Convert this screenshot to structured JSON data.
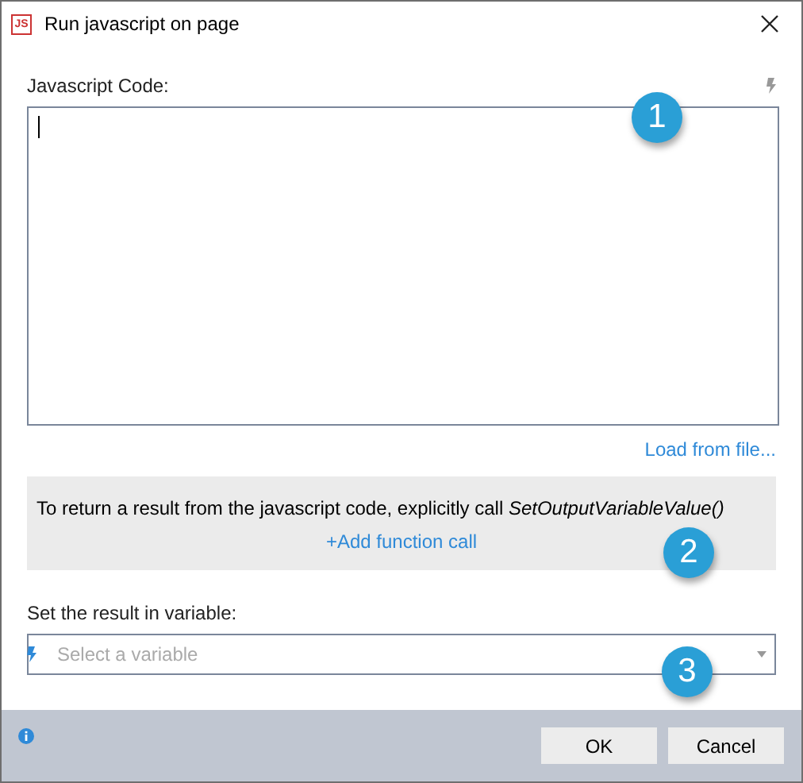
{
  "window": {
    "title": "Run javascript on page",
    "app_icon": "JS"
  },
  "code": {
    "label": "Javascript Code:",
    "focused": true,
    "callout": "1"
  },
  "load_link": "Load from file...",
  "info": {
    "text": "To return a result from the javascript code, explicitly call *SetOutputVariableValue()*",
    "link": "+Add function call",
    "callout": "2"
  },
  "variable": {
    "label": "Set the result in variable:",
    "placeholder": "Select a variable",
    "callout": "3"
  },
  "buttons": [
    "OK",
    "Cancel"
  ]
}
